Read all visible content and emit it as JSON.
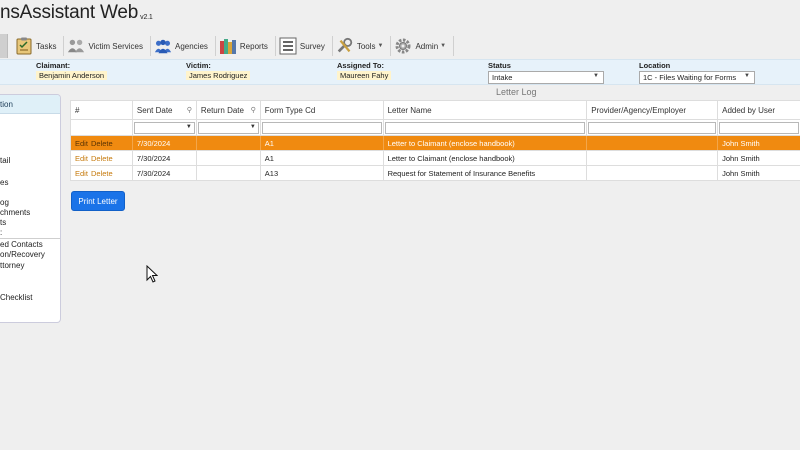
{
  "app": {
    "title": "nsAssistant Web",
    "version": "v2.1"
  },
  "toolbar": {
    "items": [
      {
        "label": "Tasks",
        "icon": "clipboard-icon"
      },
      {
        "label": "Victim Services",
        "icon": "people-icon"
      },
      {
        "label": "Agencies",
        "icon": "group-icon"
      },
      {
        "label": "Reports",
        "icon": "books-icon"
      },
      {
        "label": "Survey",
        "icon": "list-icon"
      },
      {
        "label": "Tools",
        "icon": "wrench-icon",
        "dropdown": true
      },
      {
        "label": "Admin",
        "icon": "gear-icon",
        "dropdown": true
      }
    ]
  },
  "info": {
    "claimant_label": "Claimant:",
    "claimant_value": "Benjamin Anderson",
    "victim_label": "Victim:",
    "victim_value": "James Rodriguez",
    "assigned_label": "Assigned To:",
    "assigned_value": "Maureen Fahy",
    "status_label": "Status",
    "status_value": "Intake",
    "location_label": "Location",
    "location_value": "1C - Files Waiting for Forms"
  },
  "sidebar": {
    "header": "tion",
    "items": [
      "tail",
      "es",
      "og",
      "chments",
      "ts",
      ":",
      "ed Contacts",
      "on/Recovery",
      "ttorney",
      "",
      "Checklist"
    ]
  },
  "letter_log": {
    "title": "Letter Log",
    "columns": [
      "#",
      "Sent Date",
      "Return Date",
      "Form Type Cd",
      "Letter Name",
      "Provider/Agency/Employer",
      "Added by User"
    ],
    "edit_label": "Edit",
    "delete_label": "Delete",
    "rows": [
      {
        "sent": "7/30/2024",
        "return": "",
        "form": "A1",
        "letter": "Letter to Claimant (enclose handbook)",
        "provider": "",
        "user": "John Smith",
        "selected": true
      },
      {
        "sent": "7/30/2024",
        "return": "",
        "form": "A1",
        "letter": "Letter to Claimant (enclose handbook)",
        "provider": "",
        "user": "John Smith",
        "selected": false
      },
      {
        "sent": "7/30/2024",
        "return": "",
        "form": "A13",
        "letter": "Request for Statement of Insurance Benefits",
        "provider": "",
        "user": "John Smith",
        "selected": false
      }
    ],
    "print_button": "Print Letter"
  },
  "colors": {
    "selected_row": "#f08a10",
    "primary_button": "#1a73e8",
    "link": "#c67a0c",
    "info_bar": "#e7f2fa"
  }
}
